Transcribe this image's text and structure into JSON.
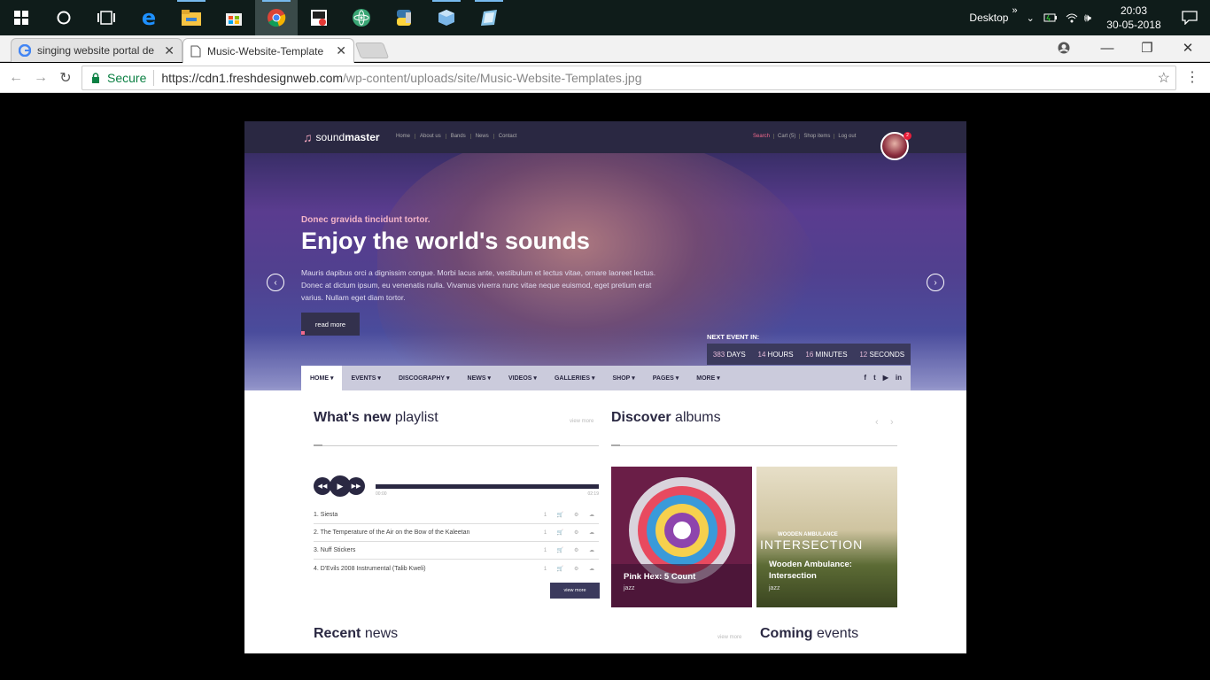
{
  "taskbar": {
    "tray_label": "Desktop",
    "time": "20:03",
    "date": "30-05-2018"
  },
  "browser": {
    "tabs": [
      {
        "label": "singing website portal de"
      },
      {
        "label": "Music-Website-Template"
      }
    ],
    "secure_label": "Secure",
    "url_main": "https://cdn1.freshdesignweb.com",
    "url_path": "/wp-content/uploads/site/Music-Website-Templates.jpg"
  },
  "site": {
    "logo_light": "sound",
    "logo_bold": "master",
    "top_nav": [
      "Home",
      "About us",
      "Bands",
      "News",
      "Contact"
    ],
    "top_nav_right": [
      "Search",
      "Cart (5)",
      "Shop items",
      "Log out"
    ],
    "avatar_badge": "2",
    "hero": {
      "subtitle": "Donec gravida tincidunt tortor.",
      "title": "Enjoy the world's sounds",
      "text": "Mauris dapibus orci a dignissim congue. Morbi lacus ante, vestibulum et lectus vitae, ornare laoreet lectus. Donec at dictum ipsum, eu venenatis nulla. Vivamus viverra nunc vitae neque euismod, eget pretium erat varius. Nullam eget diam tortor.",
      "button": "read more",
      "next_event_label": "NEXT EVENT IN:",
      "countdown": [
        {
          "value": "383",
          "unit": "DAYS"
        },
        {
          "value": "14",
          "unit": "HOURS"
        },
        {
          "value": "16",
          "unit": "MINUTES"
        },
        {
          "value": "12",
          "unit": "SECONDS"
        }
      ]
    },
    "main_nav": [
      "HOME",
      "EVENTS",
      "DISCOGRAPHY",
      "NEWS",
      "VIDEOS",
      "GALLERIES",
      "SHOP",
      "PAGES",
      "MORE"
    ],
    "playlist": {
      "title_bold": "What's new",
      "title_light": "playlist",
      "view_more": "view more",
      "time_start": "00:00",
      "time_end": "02:19",
      "tracks": [
        "1.  Siesta",
        "2.  The Temperature of the Air on the Bow of the Kaleetan",
        "3.  Nuff Stickers",
        "4.  D'Evils 2008 Instrumental (Talib Kweli)"
      ],
      "button": "view more"
    },
    "albums": {
      "title_bold": "Discover",
      "title_light": "albums",
      "items": [
        {
          "title": "Pink Hex: 5 Count",
          "genre": "jazz"
        },
        {
          "title": "Wooden Ambulance: Intersection",
          "genre": "jazz",
          "cover_top": "WOODEN AMBULANCE",
          "cover_main": "INTERSECTION"
        }
      ]
    },
    "news": {
      "title_bold": "Recent",
      "title_light": "news",
      "view_more": "view more"
    },
    "events": {
      "title_bold": "Coming",
      "title_light": "events"
    }
  }
}
